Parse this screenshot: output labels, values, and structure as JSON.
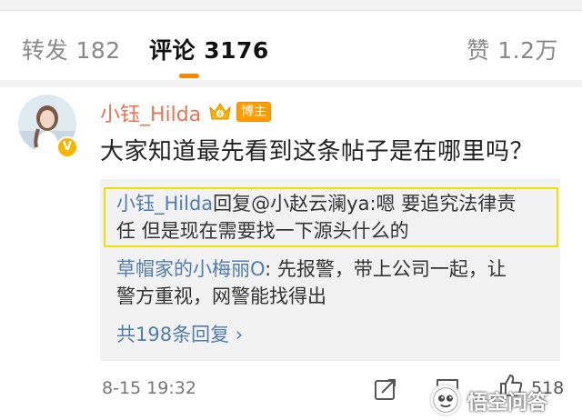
{
  "tabs": {
    "forward": "转发 182",
    "comments": "评论 3176",
    "likes": "赞 1.2万"
  },
  "comment": {
    "username": "小钰_Hilda",
    "tag": "博主",
    "text": "大家知道最先看到这条帖子是在哪里吗？",
    "time": "8-15 19:32",
    "like_count": "518"
  },
  "replies": [
    {
      "user": "小钰_Hilda",
      "line1_rest": "回复@小赵云澜ya:嗯 要追究法律责",
      "line2": "任 但是现在需要找一下源头什么的"
    },
    {
      "user": "草帽家的小梅丽O",
      "line1_rest": ": 先报警，带上公司一起，让",
      "line2": "警方重视，网警能找得出"
    }
  ],
  "more_replies": "共198条回复 ›",
  "watermark": "悟空问答",
  "colors": {
    "accent": "#ff8200",
    "username": "#eb7350",
    "link": "#507daf",
    "highlight": "#f0e000"
  },
  "icons": {
    "verified": "verified-v-icon",
    "crown": "vip-crown-icon",
    "share": "share-icon",
    "reply": "reply-icon",
    "like": "like-icon"
  }
}
